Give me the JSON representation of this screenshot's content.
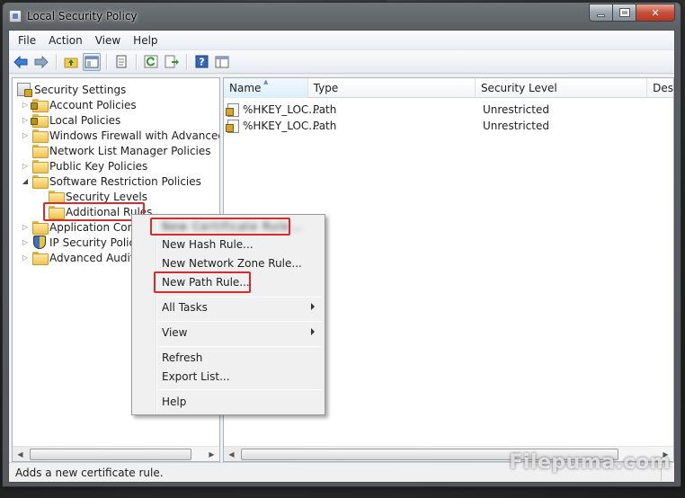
{
  "window": {
    "title": "Local Security Policy"
  },
  "menubar": [
    {
      "label": "File"
    },
    {
      "label": "Action"
    },
    {
      "label": "View"
    },
    {
      "label": "Help"
    }
  ],
  "toolbar": {
    "icons": [
      "back-arrow-icon",
      "forward-arrow-icon",
      "up-folder-icon",
      "show-hide-tree-icon",
      "properties-icon",
      "refresh-icon",
      "export-list-icon",
      "help-icon",
      "mmc-view-icon"
    ]
  },
  "tree": {
    "root": "Security Settings",
    "items": [
      {
        "label": "Account Policies"
      },
      {
        "label": "Local Policies"
      },
      {
        "label": "Windows Firewall with Advanced Securi"
      },
      {
        "label": "Network List Manager Policies"
      },
      {
        "label": "Public Key Policies"
      },
      {
        "label": "Software Restriction Policies"
      },
      {
        "label": "Security Levels"
      },
      {
        "label": "Additional Rules"
      },
      {
        "label": "Application Contr"
      },
      {
        "label": "IP Security Policie"
      },
      {
        "label": "Advanced Audit Po"
      }
    ]
  },
  "list": {
    "columns": [
      "Name",
      "Type",
      "Security Level",
      "Des"
    ],
    "rows": [
      {
        "name": "%HKEY_LOC...",
        "type": "Path",
        "level": "Unrestricted"
      },
      {
        "name": "%HKEY_LOC...",
        "type": "Path",
        "level": "Unrestricted"
      }
    ]
  },
  "context_menu": {
    "blurred_first": "New Certificate Rule...",
    "items": [
      {
        "label": "New Hash Rule..."
      },
      {
        "label": "New Network Zone Rule..."
      },
      {
        "label": "New Path Rule..."
      },
      {
        "label": "All Tasks"
      },
      {
        "label": "View"
      },
      {
        "label": "Refresh"
      },
      {
        "label": "Export List..."
      },
      {
        "label": "Help"
      }
    ]
  },
  "statusbar": {
    "text": "Adds a new certificate rule."
  },
  "watermark": "Filepuma.com",
  "colors": {
    "highlight_outline": "#d92b2b",
    "folder": "#f0c24f",
    "menu_hover": "#dbeafa"
  }
}
